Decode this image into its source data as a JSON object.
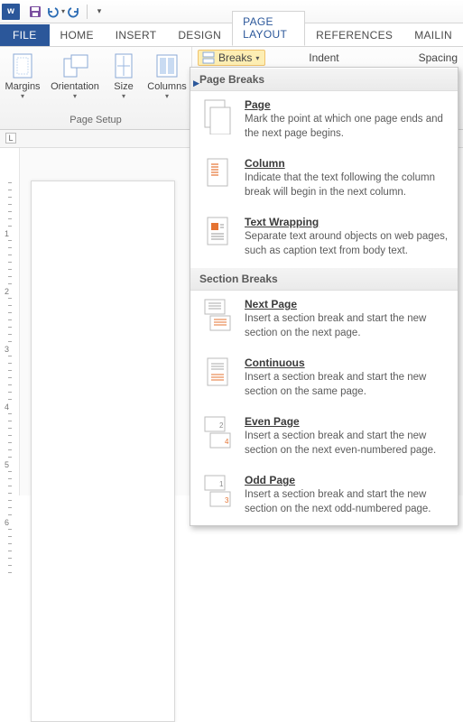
{
  "qat": {
    "app_letter": "w"
  },
  "tabs": {
    "file": "FILE",
    "home": "HOME",
    "insert": "INSERT",
    "design": "DESIGN",
    "page_layout": "PAGE LAYOUT",
    "references": "REFERENCES",
    "mailings": "MAILIN"
  },
  "ribbon": {
    "page_setup": {
      "margins": "Margins",
      "orientation": "Orientation",
      "size": "Size",
      "columns": "Columns",
      "group_label": "Page Setup"
    },
    "breaks_button": "Breaks",
    "indent_label": "Indent",
    "spacing_label": "Spacing"
  },
  "dropdown": {
    "sections": [
      {
        "header": "Page Breaks",
        "items": [
          {
            "key": "page",
            "title": "Page",
            "desc": "Mark the point at which one page ends and the next page begins."
          },
          {
            "key": "column",
            "title": "Column",
            "desc": "Indicate that the text following the column break will begin in the next column."
          },
          {
            "key": "text-wrapping",
            "title": "Text Wrapping",
            "desc": "Separate text around objects on web pages, such as caption text from body text."
          }
        ]
      },
      {
        "header": "Section Breaks",
        "items": [
          {
            "key": "next-page",
            "title": "Next Page",
            "desc": "Insert a section break and start the new section on the next page."
          },
          {
            "key": "continuous",
            "title": "Continuous",
            "desc": "Insert a section break and start the new section on the same page."
          },
          {
            "key": "even-page",
            "title": "Even Page",
            "desc": "Insert a section break and start the new section on the next even-numbered page."
          },
          {
            "key": "odd-page",
            "title": "Odd Page",
            "desc": "Insert a section break and start the new section on the next odd-numbered page."
          }
        ]
      }
    ]
  }
}
